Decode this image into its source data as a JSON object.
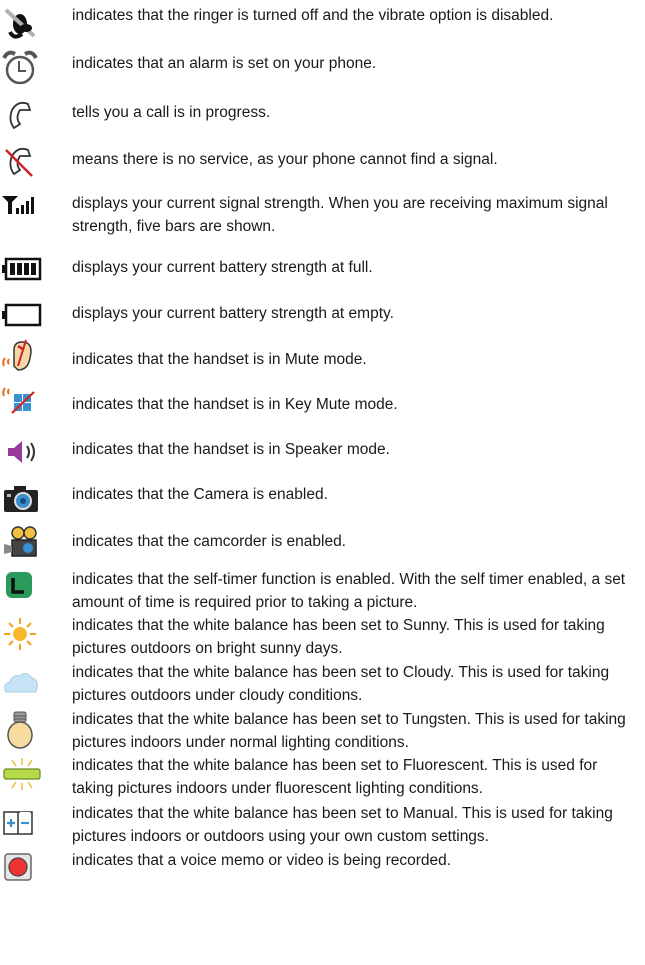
{
  "entries": [
    {
      "icon": "ringer-off-vibrate-off-icon",
      "text": "indicates that the ringer is turned off and the vibrate option is disabled."
    },
    {
      "icon": "alarm-clock-icon",
      "text": "indicates that an alarm is set on your phone."
    },
    {
      "icon": "call-in-progress-icon",
      "text": "tells you a call is in progress."
    },
    {
      "icon": "no-service-icon",
      "text": "means there is no service, as your phone cannot find a signal."
    },
    {
      "icon": "signal-strength-icon",
      "text": "displays your current signal strength. When you are receiving maximum signal strength, five bars are shown."
    },
    {
      "icon": "battery-full-icon",
      "text": "displays your current battery strength at full."
    },
    {
      "icon": "battery-empty-icon",
      "text": "displays your current battery strength at empty."
    },
    {
      "icon": "mute-mode-icon",
      "text": "indicates that the handset is in Mute mode."
    },
    {
      "icon": "key-mute-mode-icon",
      "text": "indicates that the handset is in Key Mute mode."
    },
    {
      "icon": "speaker-mode-icon",
      "text": "indicates that the handset is in Speaker mode."
    },
    {
      "icon": "camera-icon",
      "text": "indicates that the Camera is enabled."
    },
    {
      "icon": "camcorder-icon",
      "text": "indicates that the camcorder is enabled."
    },
    {
      "icon": "self-timer-icon",
      "text": "indicates that the self-timer function is enabled. With the self timer enabled, a set amount of time is required prior to taking a picture."
    },
    {
      "icon": "white-balance-sunny-icon",
      "text": "indicates that the white balance has been set to Sunny. This is used for taking pictures outdoors on bright sunny days."
    },
    {
      "icon": "white-balance-cloudy-icon",
      "text": "indicates that the white balance has been set to Cloudy. This is used for taking pictures outdoors under cloudy conditions."
    },
    {
      "icon": "white-balance-tungsten-icon",
      "text": "indicates that the white balance has been set to Tungsten. This is used for taking pictures indoors under normal lighting conditions."
    },
    {
      "icon": "white-balance-fluorescent-icon",
      "text": "indicates that the white balance has been set to Fluorescent. This is used for taking pictures indoors under fluorescent lighting conditions."
    },
    {
      "icon": "white-balance-manual-icon",
      "text": "indicates that the white balance has been set to Manual. This is used for taking pictures indoors or outdoors using your own custom settings."
    },
    {
      "icon": "recording-icon",
      "text": "indicates that a voice memo or video is being recorded."
    }
  ]
}
